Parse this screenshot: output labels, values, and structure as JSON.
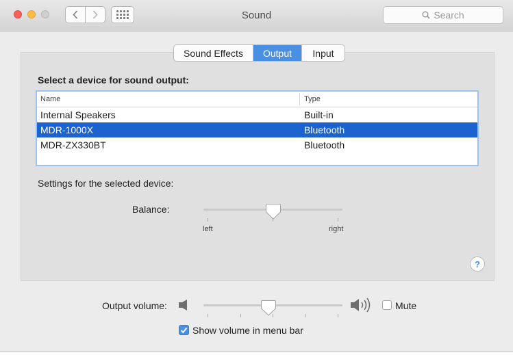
{
  "window": {
    "title": "Sound",
    "search_placeholder": "Search"
  },
  "tabs": [
    {
      "label": "Sound Effects",
      "selected": false
    },
    {
      "label": "Output",
      "selected": true
    },
    {
      "label": "Input",
      "selected": false
    }
  ],
  "output": {
    "section_label": "Select a device for sound output:",
    "columns": {
      "name": "Name",
      "type": "Type"
    },
    "devices": [
      {
        "name": "Internal Speakers",
        "type": "Built-in",
        "selected": false
      },
      {
        "name": "MDR-1000X",
        "type": "Bluetooth",
        "selected": true
      },
      {
        "name": "MDR-ZX330BT",
        "type": "Bluetooth",
        "selected": false
      }
    ],
    "settings_label": "Settings for the selected device:",
    "balance": {
      "label": "Balance:",
      "left_label": "left",
      "right_label": "right",
      "value": 0.5
    }
  },
  "help_label": "?",
  "volume": {
    "label": "Output volume:",
    "value": 0.47
  },
  "mute": {
    "label": "Mute",
    "checked": false
  },
  "show_volume": {
    "label": "Show volume in menu bar",
    "checked": true
  },
  "colors": {
    "accent": "#4a90e2",
    "selection": "#1c63d0"
  }
}
